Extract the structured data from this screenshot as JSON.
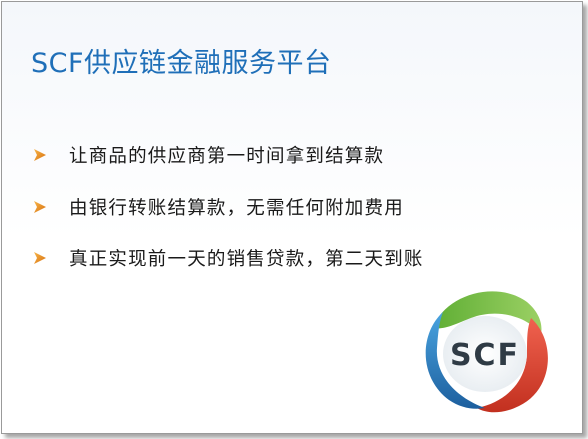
{
  "slide": {
    "title": "SCF供应链金融服务平台",
    "bullets": [
      "让商品的供应商第一时间拿到结算款",
      "由银行转账结算款，无需任何附加费用",
      "真正实现前一天的销售贷款，第二天到账"
    ],
    "bullet_icon": "orange-arrow-icon",
    "logo": {
      "text": "SCF",
      "icon": "scf-tri-swirl-logo",
      "colors": [
        "#2e86c8",
        "#7cc04a",
        "#e0463a"
      ]
    },
    "colors": {
      "title": "#1f6fb8",
      "bullet": "#e8891c",
      "text": "#1a1a1a"
    }
  }
}
